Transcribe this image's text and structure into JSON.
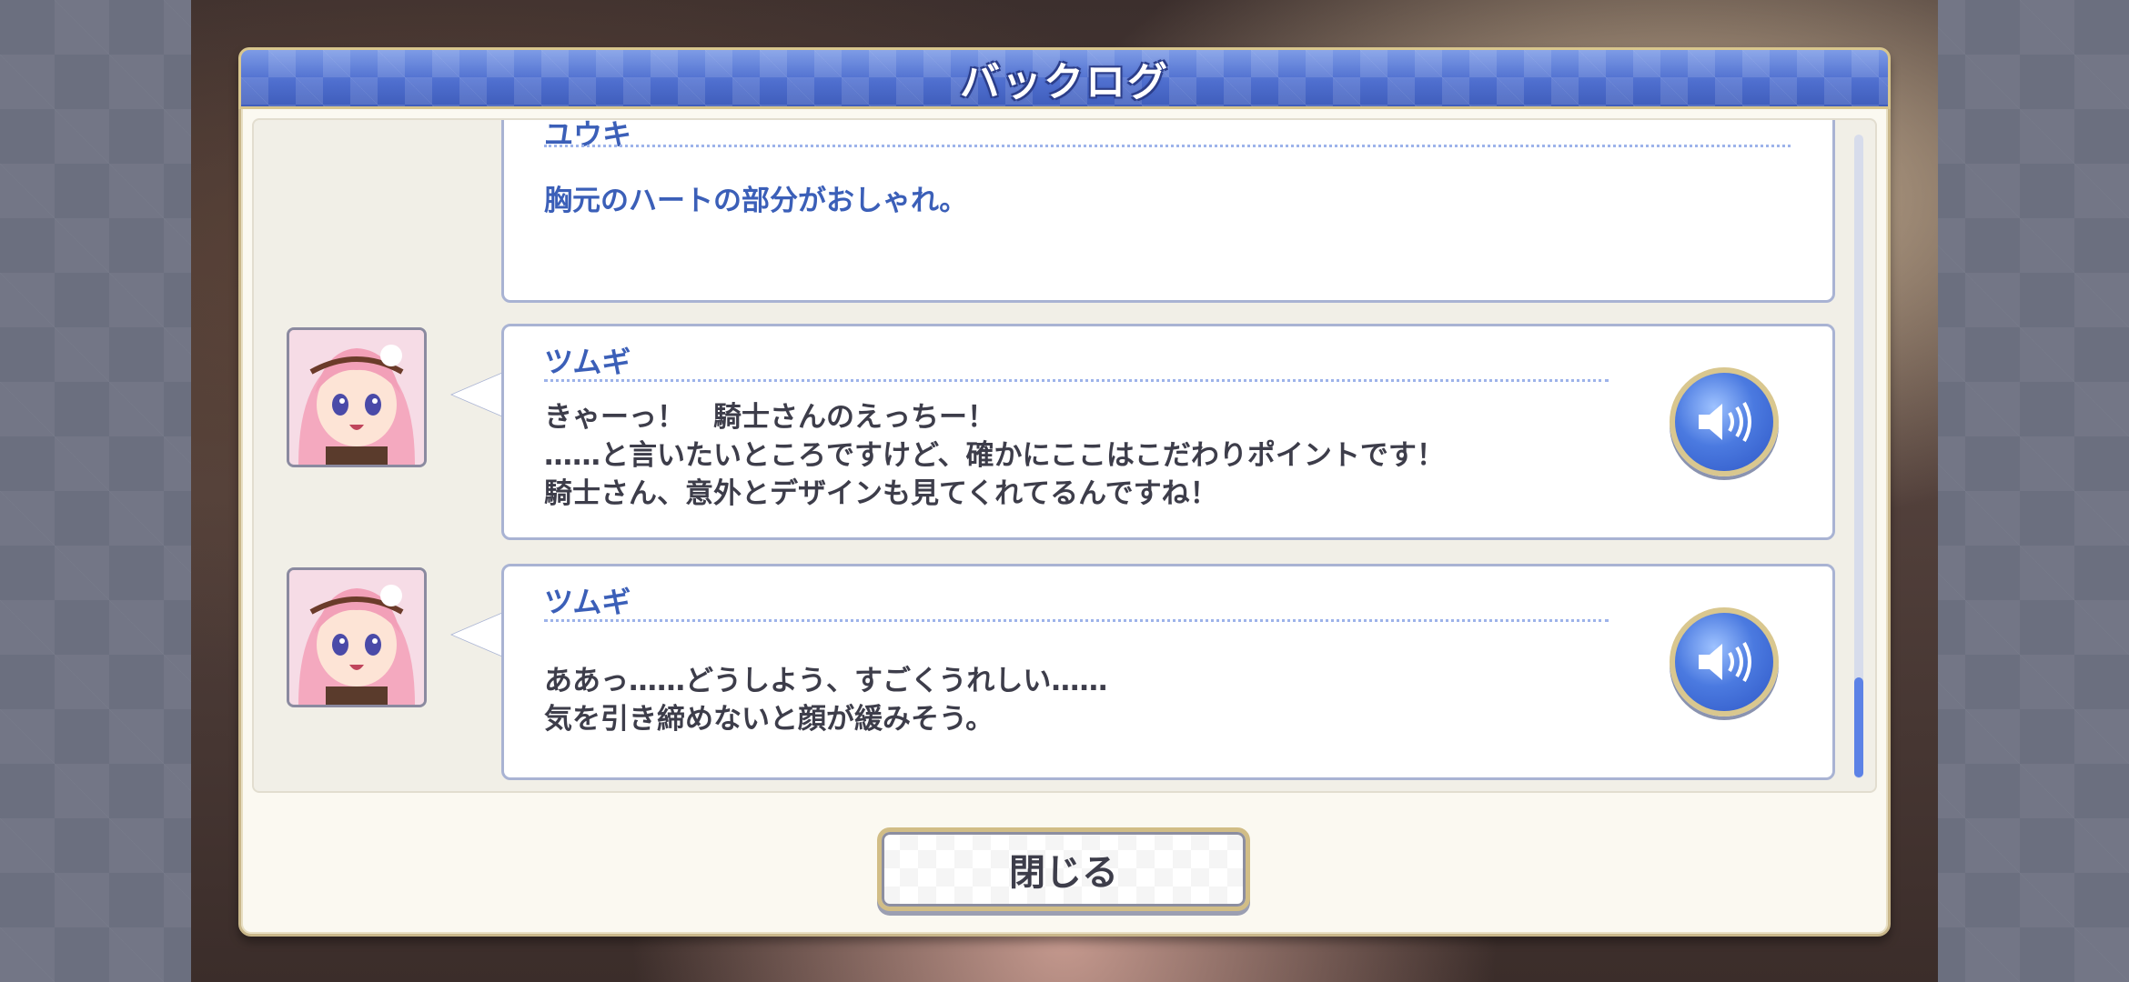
{
  "window": {
    "title": "バックログ"
  },
  "entries": [
    {
      "speaker": "ユウキ",
      "lines": [
        "胸元のハートの部分がおしゃれ。"
      ],
      "has_avatar": false,
      "has_voice": false
    },
    {
      "speaker": "ツムギ",
      "lines": [
        "きゃーっ！　騎士さんのえっちー！",
        "……と言いたいところですけど、確かにここはこだわりポイントです！",
        "騎士さん、意外とデザインも見てくれてるんですね！"
      ],
      "has_avatar": true,
      "has_voice": true
    },
    {
      "speaker": "ツムギ",
      "lines": [
        "ああっ……どうしよう、すごくうれしい……",
        "気を引き締めないと顔が緩みそう。"
      ],
      "has_avatar": true,
      "has_voice": true
    }
  ],
  "footer": {
    "close_label": "閉じる"
  },
  "colors": {
    "title_bar": "#4f6fcf",
    "speaker_text": "#3b5fb8",
    "dialog_text": "#3d3d4a",
    "scroll_thumb": "#5c82e6",
    "gold_border": "#d1bd86"
  },
  "icons": {
    "voice": "speaker-icon",
    "avatar": "character-portrait"
  }
}
